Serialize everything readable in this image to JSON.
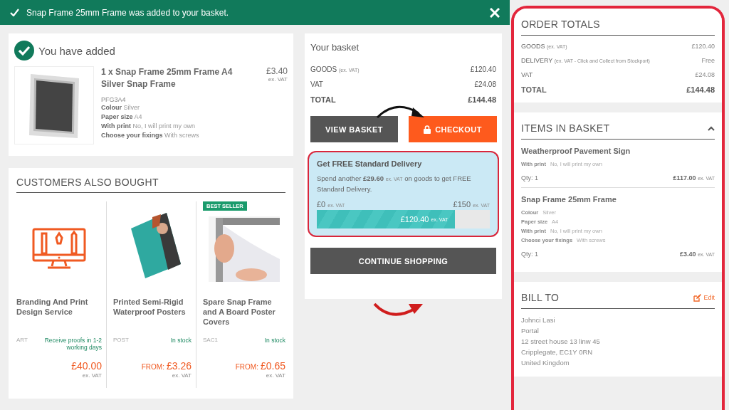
{
  "notification": {
    "text": "Snap Frame 25mm Frame was added to your basket."
  },
  "added": {
    "title": "You have added",
    "product": {
      "name": "1 x Snap Frame 25mm Frame A4 Silver Snap Frame",
      "price": "£3.40",
      "price_note": "ex. VAT",
      "sku": "PFG3A4",
      "attributes": [
        {
          "label": "Colour",
          "value": "Silver"
        },
        {
          "label": "Paper size",
          "value": "A4"
        },
        {
          "label": "With print",
          "value": "No, I will print my own"
        },
        {
          "label": "Choose your fixings",
          "value": "With screws"
        }
      ]
    }
  },
  "also_bought": {
    "title": "CUSTOMERS ALSO BOUGHT",
    "products": [
      {
        "kind": "icon",
        "name": "Branding And Print Design Service",
        "code": "ART",
        "stock": "Receive proofs in 1-2 working days",
        "price": "£40.00",
        "price_note": "ex. VAT"
      },
      {
        "kind": "picture",
        "name": "Printed Semi-Rigid Waterproof Posters",
        "code": "POST",
        "stock": "In stock",
        "price_prefix": "FROM:",
        "price": "£3.26",
        "price_note": "ex. VAT"
      },
      {
        "kind": "picture",
        "badge": "BEST SELLER",
        "name": "Spare Snap Frame and A Board Poster Covers",
        "code": "SAC1",
        "stock": "In stock",
        "price_prefix": "FROM:",
        "price": "£0.65",
        "price_note": "ex. VAT"
      }
    ]
  },
  "basket": {
    "title": "Your basket",
    "rows": [
      {
        "label": "GOODS",
        "note": "(ex. VAT)",
        "value": "£120.40",
        "bold": false
      },
      {
        "label": "VAT",
        "value": "£24.08",
        "bold": false
      },
      {
        "label": "TOTAL",
        "value": "£144.48",
        "bold": true
      }
    ],
    "view_button": "VIEW BASKET",
    "checkout_button": "CHECKOUT",
    "delivery": {
      "title": "Get FREE Standard Delivery",
      "text_before": "Spend another",
      "amount": "£29.60",
      "amount_note": "ex. VAT",
      "text_after": "on goods to get FREE Standard Delivery.",
      "min": "£0",
      "min_note": "ex. VAT",
      "max": "£150",
      "max_note": "ex. VAT",
      "level": 0.8,
      "bar_label": "£120.40",
      "bar_note": "ex. VAT"
    },
    "continue_button": "CONTINUE SHOPPING"
  },
  "order_totals": {
    "title": "ORDER TOTALS",
    "rows": [
      {
        "label": "GOODS",
        "note": "(ex. VAT)",
        "value": "£120.40",
        "bold": false
      },
      {
        "label": "DELIVERY",
        "note": "(ex. VAT - Click and Collect from Stockport)",
        "value": "Free",
        "bold": false
      },
      {
        "label": "VAT",
        "value": "£24.08",
        "bold": false
      },
      {
        "label": "TOTAL",
        "value": "£144.48",
        "bold": true
      }
    ]
  },
  "items_in_basket": {
    "title": "ITEMS IN BASKET",
    "expanded": true,
    "items": [
      {
        "name": "Weatherproof Pavement Sign",
        "attributes": [
          {
            "label": "With print",
            "value": "No, I will print my own"
          }
        ],
        "qty": "Qty: 1",
        "price": "£117.00",
        "price_note": "ex. VAT"
      },
      {
        "name": "Snap Frame 25mm Frame",
        "attributes": [
          {
            "label": "Colour",
            "value": "Silver"
          },
          {
            "label": "Paper size",
            "value": "A4"
          },
          {
            "label": "With print",
            "value": "No, I will print my own"
          },
          {
            "label": "Choose your fixings",
            "value": "With screws"
          }
        ],
        "qty": "Qty: 1",
        "price": "£3.40",
        "price_note": "ex. VAT"
      }
    ]
  },
  "bill_to": {
    "title": "BILL TO",
    "edit": "Edit",
    "lines": [
      "Johnci Lasi",
      "Portal",
      "12 street house 13 linw 45",
      "Cripplegate, EC1Y 0RN",
      "United Kingdom"
    ]
  }
}
